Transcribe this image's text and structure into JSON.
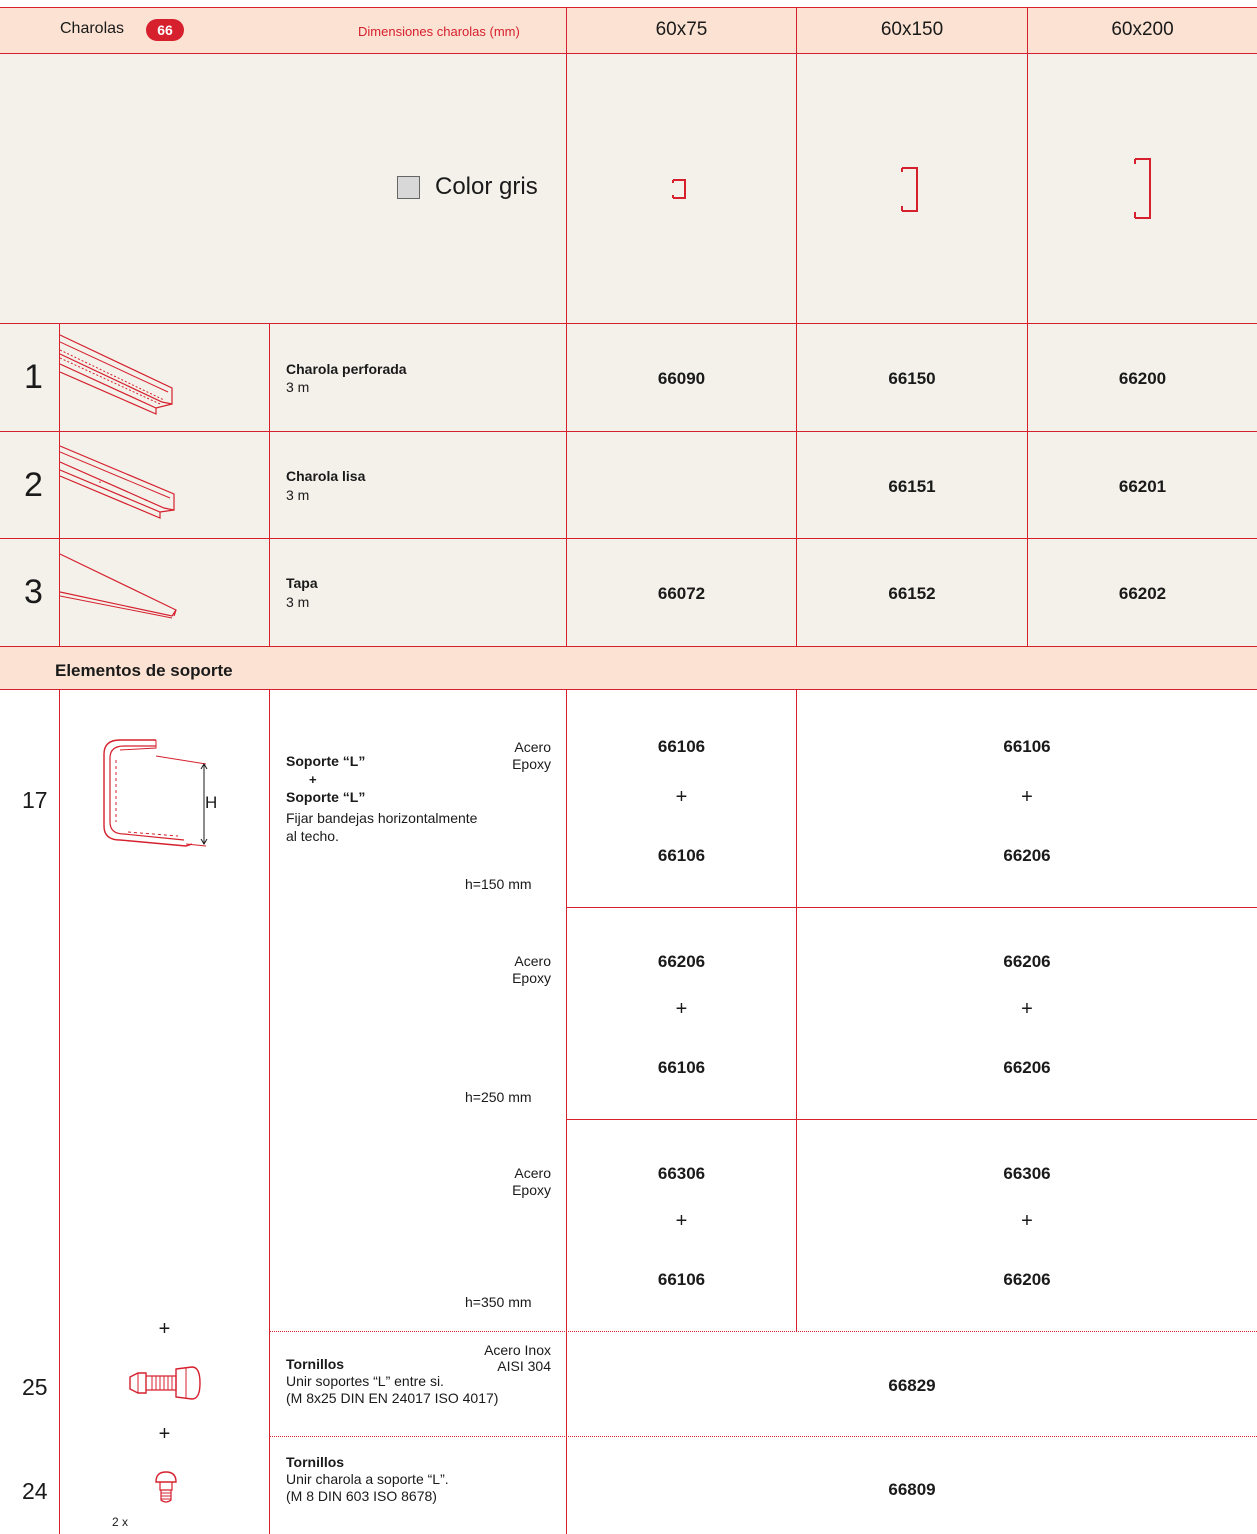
{
  "header": {
    "title": "Charolas",
    "badge": "66",
    "dimensions_label": "Dimensiones charolas (mm)",
    "sizes": [
      "60x75",
      "60x150",
      "60x200"
    ]
  },
  "color_legend": {
    "label": "Color gris",
    "swatch_color": "#d8d8d8"
  },
  "products": [
    {
      "num": "1",
      "name": "Charola perforada",
      "length": "3 m",
      "codes": [
        "66090",
        "66150",
        "66200"
      ]
    },
    {
      "num": "2",
      "name": "Charola lisa",
      "length": "3 m",
      "codes": [
        "",
        "66151",
        "66201"
      ]
    },
    {
      "num": "3",
      "name": "Tapa",
      "length": "3 m",
      "codes": [
        "66072",
        "66152",
        "66202"
      ]
    }
  ],
  "support_section": {
    "title": "Elementos de soporte",
    "item17": {
      "num": "17",
      "name1": "Soporte “L”",
      "plus": "+",
      "name2": "Soporte “L”",
      "desc1": "Fijar bandejas horizontalmente",
      "desc2": "al techo.",
      "dim_label": "H",
      "blocks": [
        {
          "material1": "Acero",
          "material2": "Epoxy",
          "height": "h=150 mm",
          "a_top": "66106",
          "a_bot": "66106",
          "b_top": "66106",
          "b_bot": "66206"
        },
        {
          "material1": "Acero",
          "material2": "Epoxy",
          "height": "h=250 mm",
          "a_top": "66206",
          "a_bot": "66106",
          "b_top": "66206",
          "b_bot": "66206"
        },
        {
          "material1": "Acero",
          "material2": "Epoxy",
          "height": "h=350 mm",
          "a_top": "66306",
          "a_bot": "66106",
          "b_top": "66306",
          "b_bot": "66206"
        }
      ]
    },
    "item25": {
      "num": "25",
      "plus": "+",
      "name": "Tornillos",
      "desc1": "Unir soportes “L” entre si.",
      "desc2": "(M 8x25 DIN EN 24017 ISO 4017)",
      "material1": "Acero Inox",
      "material2": "AISI 304",
      "code": "66829"
    },
    "item24": {
      "num": "24",
      "plus": "+",
      "name": "Tornillos",
      "desc1": "Unir charola a soporte “L”.",
      "desc2": "(M 8 DIN 603 ISO 8678)",
      "qty": "2 x",
      "code": "66809"
    }
  },
  "colors": {
    "accent": "#d6202e",
    "header_bg": "#fbe2d2",
    "row_bg": "#f3f1ea"
  }
}
